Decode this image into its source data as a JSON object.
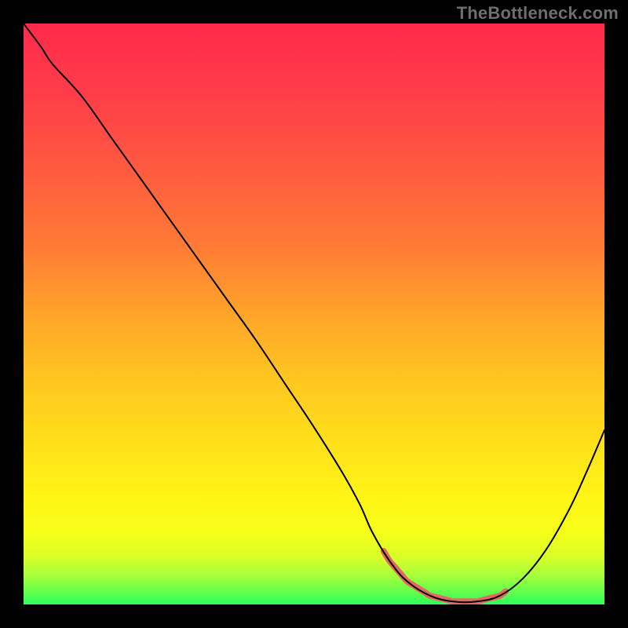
{
  "attribution": "TheBottleneck.com",
  "colors": {
    "frame": "#000000",
    "attribution_text": "#6e6e6e",
    "curve_stroke": "#000000",
    "curve_stroke_width": 2,
    "highlight_stroke": "#e36a62",
    "highlight_stroke_width": 8,
    "gradient_stops": [
      {
        "offset": 0.0,
        "color": "#ff2a4a"
      },
      {
        "offset": 0.12,
        "color": "#ff3d4a"
      },
      {
        "offset": 0.25,
        "color": "#ff5a40"
      },
      {
        "offset": 0.38,
        "color": "#ff7a35"
      },
      {
        "offset": 0.5,
        "color": "#ffa42a"
      },
      {
        "offset": 0.62,
        "color": "#ffc820"
      },
      {
        "offset": 0.74,
        "color": "#ffe41a"
      },
      {
        "offset": 0.82,
        "color": "#fff615"
      },
      {
        "offset": 0.88,
        "color": "#f5ff1a"
      },
      {
        "offset": 0.92,
        "color": "#d7ff2a"
      },
      {
        "offset": 0.95,
        "color": "#a7ff3a"
      },
      {
        "offset": 0.975,
        "color": "#6bff4a"
      },
      {
        "offset": 1.0,
        "color": "#2dff5a"
      }
    ]
  },
  "chart_data": {
    "type": "line",
    "title": "",
    "xlabel": "",
    "ylabel": "",
    "xlim": [
      0,
      100
    ],
    "ylim": [
      0,
      100
    ],
    "x": [
      0,
      3,
      5,
      10,
      15,
      20,
      25,
      30,
      35,
      40,
      45,
      50,
      55,
      58,
      60,
      63,
      66,
      70,
      74,
      78,
      82,
      86,
      90,
      94,
      97,
      100
    ],
    "values": [
      100,
      96,
      93,
      87.5,
      80.5,
      73.5,
      66.5,
      59.5,
      52.5,
      45.5,
      38,
      30.5,
      22.5,
      17,
      12.5,
      7.5,
      4,
      1.5,
      0.5,
      0.5,
      1.5,
      4.5,
      9.5,
      16.5,
      23,
      30
    ],
    "highlight_range_x": [
      62,
      83
    ],
    "annotations": []
  }
}
